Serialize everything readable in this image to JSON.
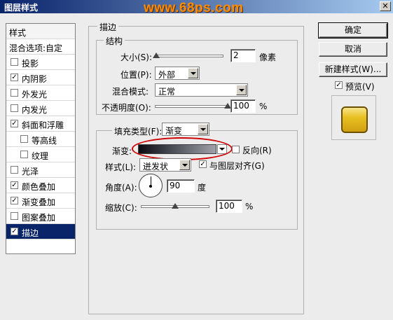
{
  "window": {
    "title": "图层样式",
    "watermark": "www.68ps.com",
    "close_glyph": "✕"
  },
  "styles_panel": {
    "header": "样式",
    "blend_options": "混合选项:自定",
    "items": [
      {
        "label": "投影",
        "checked": false,
        "indent": false,
        "selected": false
      },
      {
        "label": "内阴影",
        "checked": true,
        "indent": false,
        "selected": false
      },
      {
        "label": "外发光",
        "checked": false,
        "indent": false,
        "selected": false
      },
      {
        "label": "内发光",
        "checked": false,
        "indent": false,
        "selected": false
      },
      {
        "label": "斜面和浮雕",
        "checked": true,
        "indent": false,
        "selected": false
      },
      {
        "label": "等高线",
        "checked": false,
        "indent": true,
        "selected": false
      },
      {
        "label": "纹理",
        "checked": false,
        "indent": true,
        "selected": false
      },
      {
        "label": "光泽",
        "checked": false,
        "indent": false,
        "selected": false
      },
      {
        "label": "颜色叠加",
        "checked": true,
        "indent": false,
        "selected": false
      },
      {
        "label": "渐变叠加",
        "checked": true,
        "indent": false,
        "selected": false
      },
      {
        "label": "图案叠加",
        "checked": false,
        "indent": false,
        "selected": false
      },
      {
        "label": "描边",
        "checked": true,
        "indent": false,
        "selected": true
      }
    ]
  },
  "stroke": {
    "group_title": "描边",
    "structure": {
      "title": "结构",
      "size_label": "大小(S):",
      "size_value": "2",
      "size_unit": "像素",
      "size_slider_fraction": 0.02,
      "position_label": "位置(P):",
      "position_value": "外部",
      "blend_mode_label": "混合模式:",
      "blend_mode_value": "正常",
      "opacity_label": "不透明度(O):",
      "opacity_value": "100",
      "opacity_unit": "%",
      "opacity_slider_fraction": 1.0
    },
    "fill": {
      "fill_type_label": "填充类型(F):",
      "fill_type_value": "渐变",
      "gradient_label": "渐变:",
      "reverse_label": "反向(R)",
      "reverse_checked": false,
      "style_label": "样式(L):",
      "style_value": "迸发状",
      "align_label": "与图层对齐(G)",
      "align_checked": true,
      "angle_label": "角度(A):",
      "angle_value": "90",
      "angle_unit": "度",
      "scale_label": "缩放(C):",
      "scale_value": "100",
      "scale_unit": "%",
      "scale_slider_fraction": 0.5
    }
  },
  "buttons": {
    "ok": "确定",
    "cancel": "取消",
    "new_style": "新建样式(W)...",
    "preview_label": "预览(V)",
    "preview_checked": true
  },
  "colors": {
    "title_bar": "#0a246a",
    "selection": "#0a246a",
    "highlight_ellipse": "#d00000",
    "watermark": "#ff8c00"
  }
}
